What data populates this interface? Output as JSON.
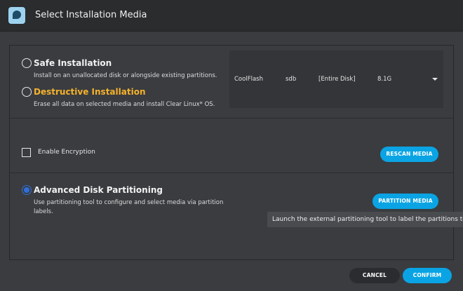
{
  "window": {
    "title": "Select Installation Media"
  },
  "safe": {
    "title": "Safe Installation",
    "desc": "Install on an unallocated disk or alongside existing partitions."
  },
  "destructive": {
    "title": "Destructive Installation",
    "desc": "Erase all data on selected media and install Clear Linux* OS."
  },
  "media": {
    "name": "CoolFlash",
    "device": "sdb",
    "partition": "[Entire Disk]",
    "size": "8.1G"
  },
  "encryption": {
    "label": "Enable Encryption",
    "checked": false
  },
  "rescan": {
    "label": "RESCAN MEDIA"
  },
  "advanced": {
    "title": "Advanced Disk Partitioning",
    "desc_line1": "Use partitioning tool to configure and select media via partition",
    "desc_line2": "labels.",
    "selected": true
  },
  "partition_button": {
    "label": "PARTITION MEDIA"
  },
  "tooltip": {
    "text": "Launch the external partitioning tool to label the partitions to be"
  },
  "footer": {
    "cancel": "CANCEL",
    "confirm": "CONFIRM"
  },
  "colors": {
    "accent": "#0aa4e4",
    "warning": "#f6b22b",
    "radio_selected": "#2f6fd8"
  }
}
